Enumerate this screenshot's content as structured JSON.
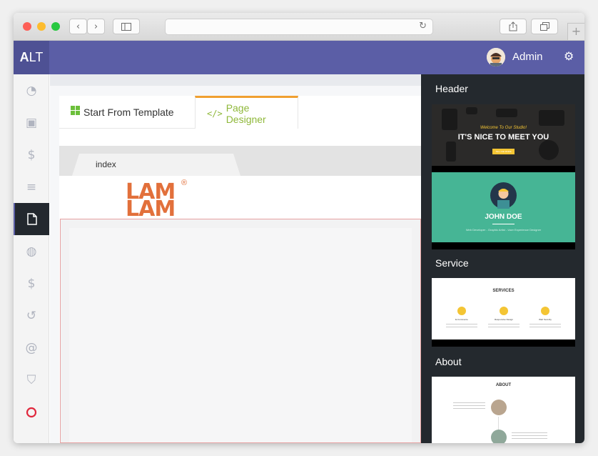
{
  "browser": {
    "back_icon": "chevron-left-icon",
    "forward_icon": "chevron-right-icon",
    "sidebar_icon": "sidebar-icon",
    "reload_icon": "reload-icon",
    "share_icon": "share-icon",
    "tabs_icon": "tabs-icon",
    "new_tab_label": "+"
  },
  "app": {
    "logo_bold": "A",
    "logo_rest": "LT",
    "user_name": "Admin",
    "settings_icon": "gears-icon",
    "accent_color": "#5b5ea6"
  },
  "sidebar": {
    "items": [
      {
        "icon": "dashboard-icon",
        "glyph": "◔"
      },
      {
        "icon": "money-icon",
        "glyph": "▣"
      },
      {
        "icon": "dollar-icon",
        "glyph": "$"
      },
      {
        "icon": "database-icon",
        "glyph": "≡"
      },
      {
        "icon": "page-icon",
        "glyph": "▢",
        "active": true
      },
      {
        "icon": "globe-icon",
        "glyph": "◍"
      },
      {
        "icon": "dollar-icon",
        "glyph": "$"
      },
      {
        "icon": "history-icon",
        "glyph": "↺"
      },
      {
        "icon": "at-icon",
        "glyph": "@"
      },
      {
        "icon": "shield-icon",
        "glyph": "⛉"
      },
      {
        "icon": "circle-icon",
        "glyph": "○"
      }
    ]
  },
  "tabs": {
    "template_label": "Start From Template",
    "designer_label": "Page Designer",
    "template_icon": "grid-icon",
    "designer_icon": "code-icon"
  },
  "page_tabs": {
    "active": "index"
  },
  "canvas": {
    "logo_line1": "LAM",
    "logo_line2": "LAM",
    "logo_mark": "®"
  },
  "blocks_panel": {
    "sections": [
      {
        "title": "Header"
      },
      {
        "title": "Service"
      },
      {
        "title": "About"
      }
    ],
    "header_thumb": {
      "welcome": "Welcome To Our Studio!",
      "headline": "IT'S NICE TO MEET YOU",
      "button": "TELL ME MORE"
    },
    "profile_thumb": {
      "name": "JOHN DOE",
      "subtitle": "Web Developer - Graphic Artist - User Experience Designer"
    },
    "service_thumb": {
      "title": "SERVICES",
      "items": [
        "E-Commerce",
        "Responsive Design",
        "Web Security"
      ]
    },
    "about_thumb": {
      "title": "ABOUT"
    }
  }
}
